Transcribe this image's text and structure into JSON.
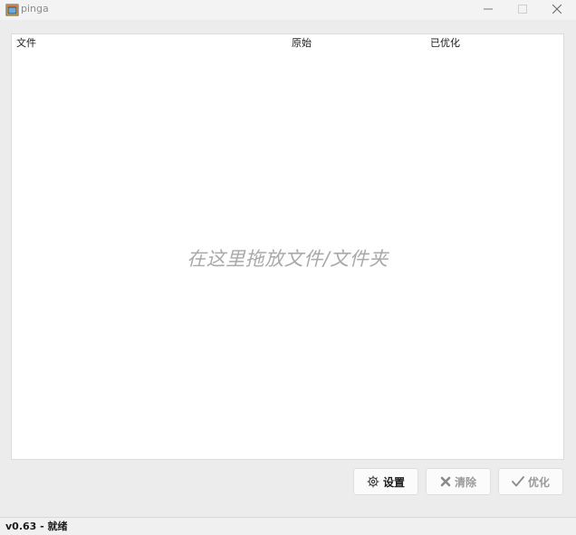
{
  "window": {
    "title": "pinga",
    "icon": "app-icon"
  },
  "file_list": {
    "columns": [
      "文件",
      "原始",
      "已优化"
    ],
    "drop_hint": "在这里拖放文件/文件夹"
  },
  "buttons": {
    "settings": {
      "label": "设置",
      "icon": "gear-icon"
    },
    "clear": {
      "label": "清除",
      "icon": "cross-icon"
    },
    "optimize": {
      "label": "优化",
      "icon": "check-icon"
    }
  },
  "status": {
    "text": "v0.63 - 就绪"
  }
}
